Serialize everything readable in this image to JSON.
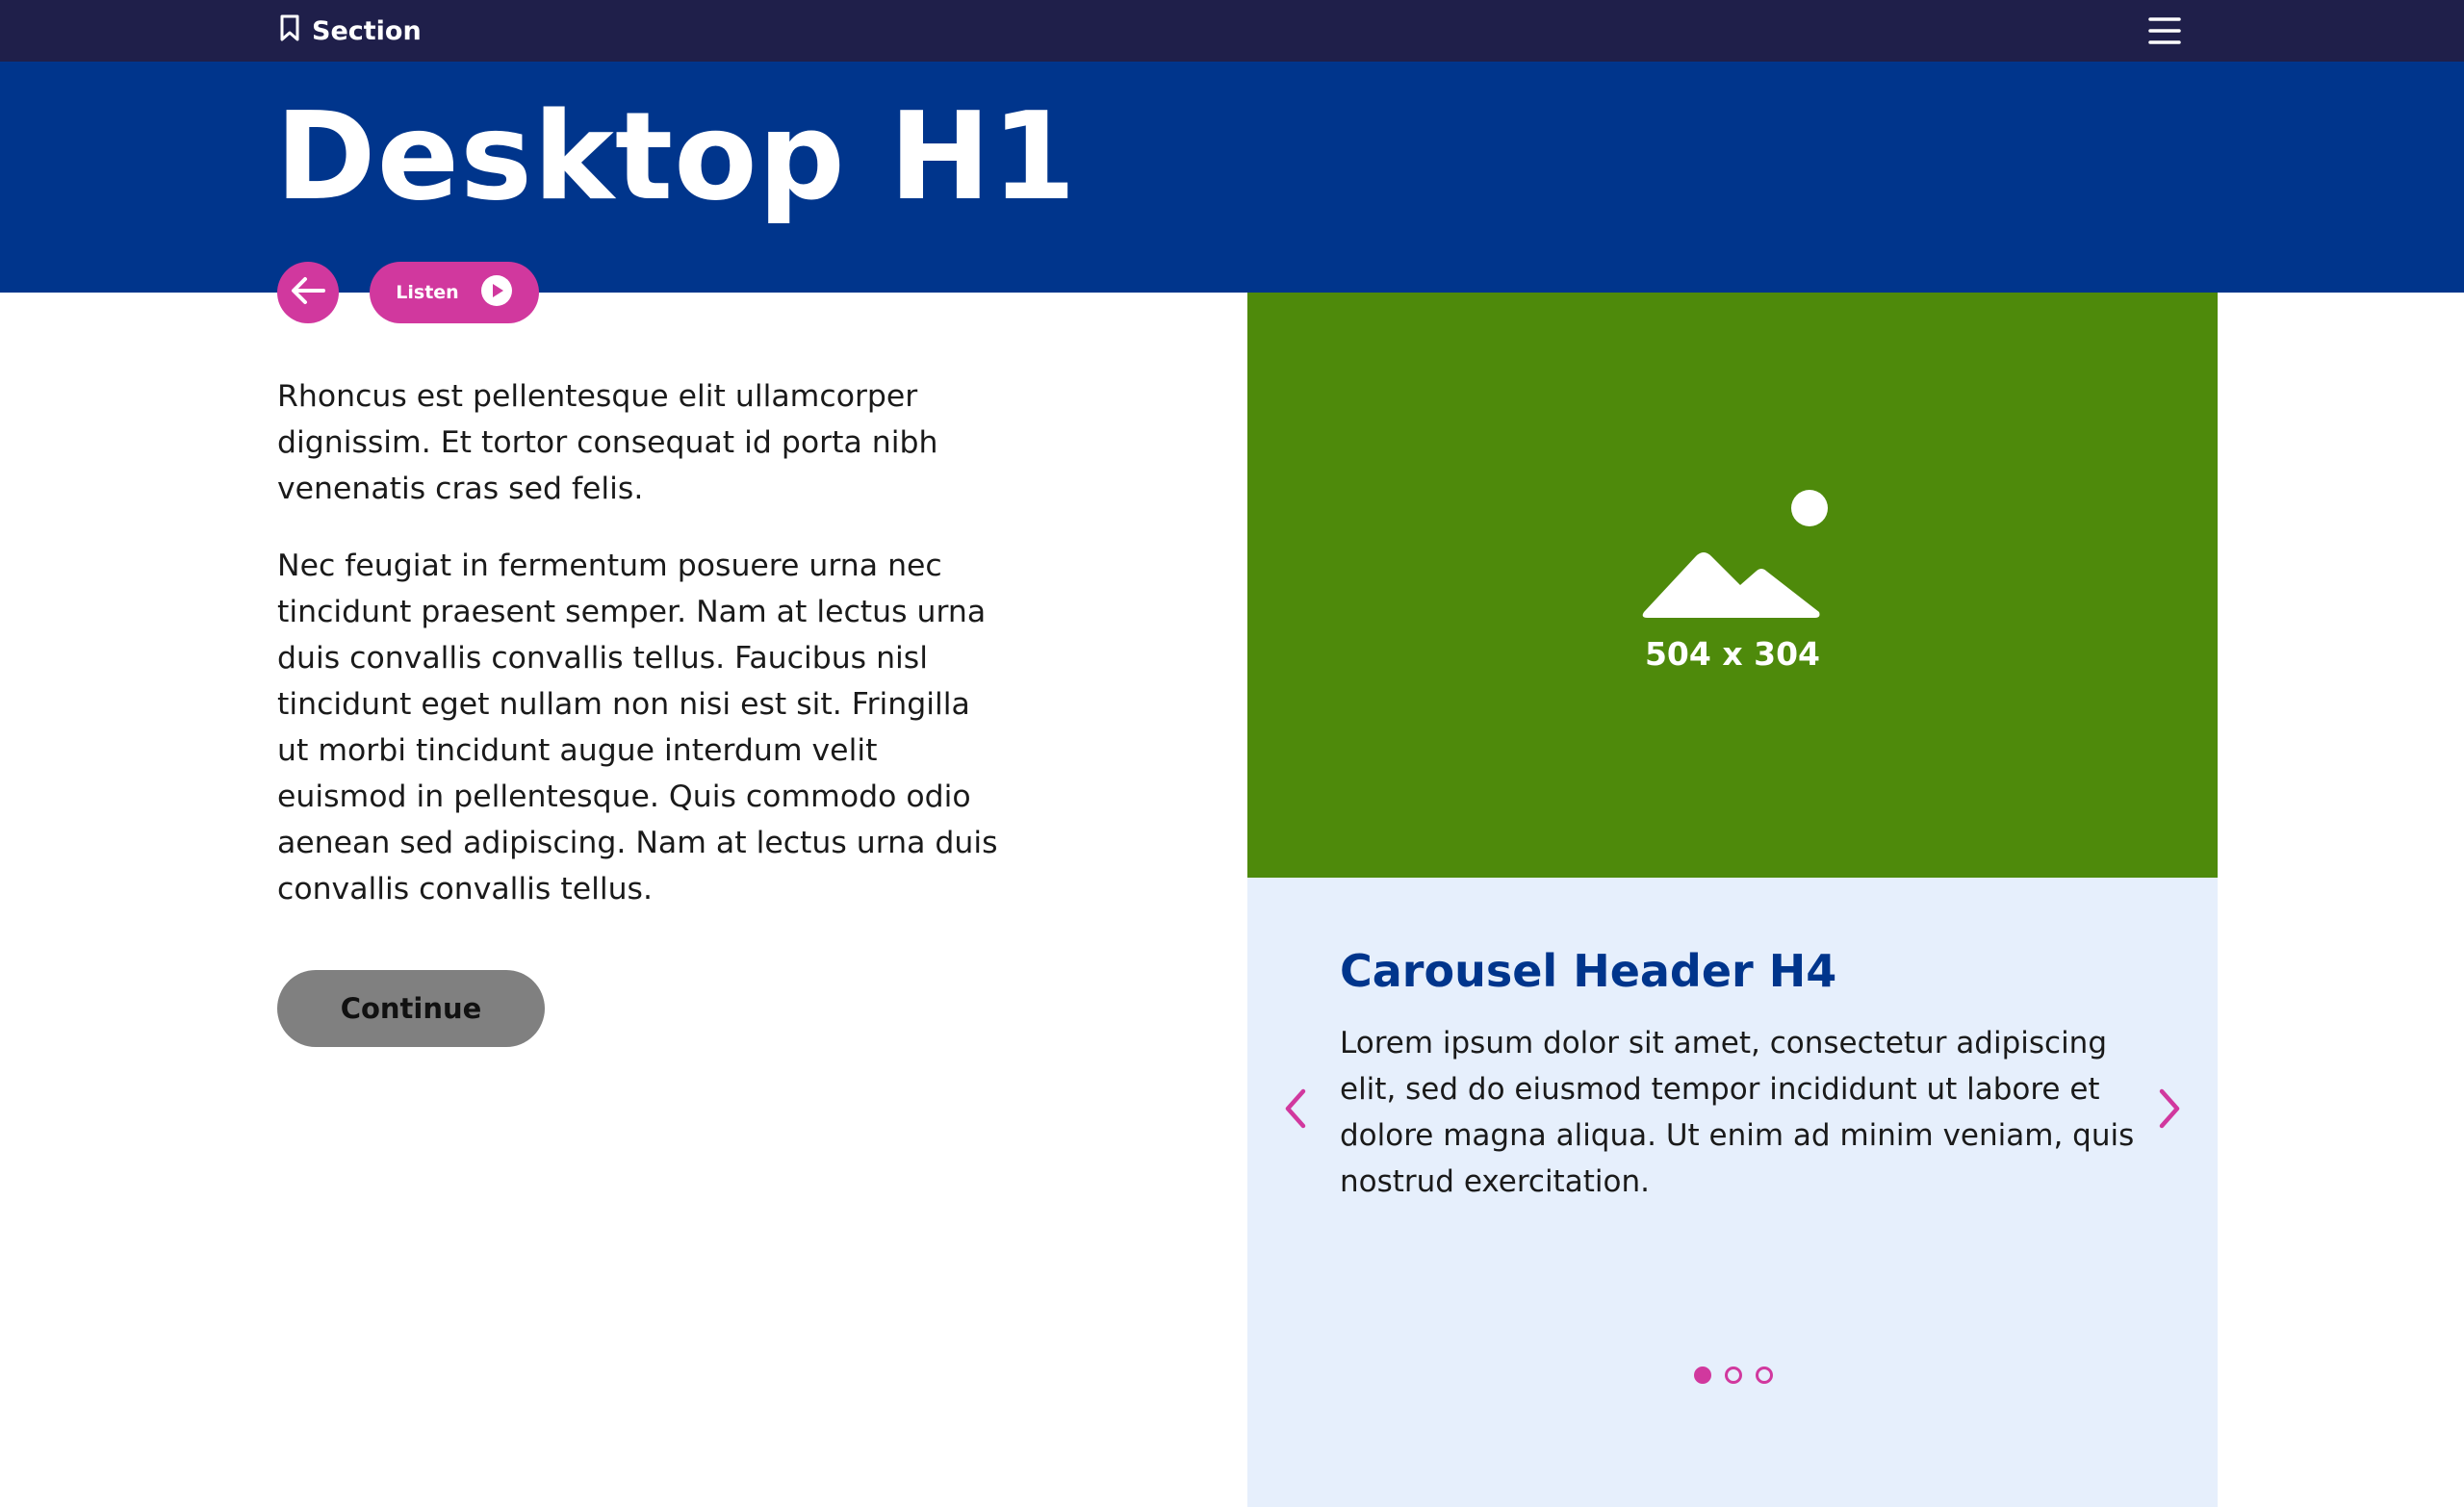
{
  "topbar": {
    "section_label": "Section",
    "section_icon": "bookmark-icon",
    "menu_icon": "hamburger-menu-icon"
  },
  "hero": {
    "title": "Desktop H1"
  },
  "actions": {
    "back_icon": "arrow-left-icon",
    "listen_label": "Listen",
    "listen_icon": "play-icon"
  },
  "content": {
    "paragraphs": [
      "Rhoncus est pellentesque elit ullamcorper dignissim. Et tortor consequat id porta nibh venenatis cras sed felis.",
      "Nec feugiat in fermentum posuere urna nec tincidunt praesent semper. Nam at lectus urna duis convallis convallis tellus. Faucibus nisl tincidunt eget nullam non nisi est sit. Fringilla ut morbi tincidunt augue interdum velit euismod in pellentesque. Quis commodo odio aenean sed adipiscing. Nam at lectus urna duis convallis convallis tellus."
    ],
    "continue_label": "Continue"
  },
  "media": {
    "placeholder_icon": "image-placeholder-icon",
    "placeholder_label": "504 x 304"
  },
  "carousel": {
    "header": "Carousel Header H4",
    "text": "Lorem ipsum dolor sit amet, consectetur adipiscing elit, sed do eiusmod tempor incididunt ut labore et dolore magna aliqua. Ut enim ad minim veniam, quis nostrud exercitation.",
    "prev_icon": "chevron-left-icon",
    "next_icon": "chevron-right-icon",
    "slide_count": 3,
    "active_slide": 1
  },
  "colors": {
    "topbar": "#1f1f4a",
    "hero": "#00358c",
    "accent": "#d1389e",
    "media": "#4e8a0b",
    "carousel_bg": "#e6effc",
    "button_gray": "#808080"
  }
}
